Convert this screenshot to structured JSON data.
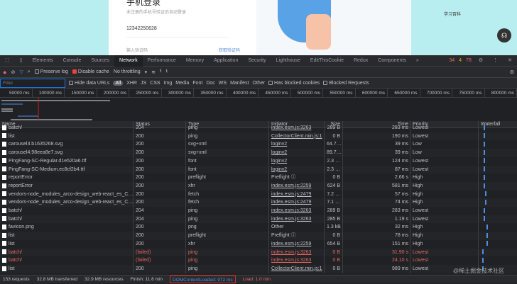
{
  "page": {
    "title": "手机登录",
    "subtitle": "未注册的手机号验证后自动登录",
    "phone": "12342250628",
    "code_placeholder": "输入验证码",
    "get_code": "获取验证码",
    "wiki": "学习百科"
  },
  "devtools": {
    "tabs": [
      "Elements",
      "Console",
      "Sources",
      "Network",
      "Performance",
      "Memory",
      "Application",
      "Security",
      "Lighthouse",
      "EditThisCookie",
      "Redux",
      "Components",
      "»"
    ],
    "active_tab": "Network",
    "badges": {
      "errors": "34",
      "warnings": "4",
      "issues": "78"
    },
    "toolbar": {
      "preserve_log": "Preserve log",
      "disable_cache": "Disable cache",
      "throttling": "No throttling"
    },
    "filter": {
      "placeholder": "Filter",
      "hide_data_urls": "Hide data URLs",
      "types": [
        "All",
        "XHR",
        "JS",
        "CSS",
        "Img",
        "Media",
        "Font",
        "Doc",
        "WS",
        "Manifest",
        "Other"
      ],
      "blocked_cookies": "Has blocked cookies",
      "blocked_requests": "Blocked Requests"
    },
    "timeline": [
      "50000 ms",
      "100000 ms",
      "150000 ms",
      "200000 ms",
      "250000 ms",
      "300000 ms",
      "350000 ms",
      "400000 ms",
      "450000 ms",
      "500000 ms",
      "550000 ms",
      "600000 ms",
      "650000 ms",
      "700000 ms",
      "750000 ms",
      "800000 ms"
    ],
    "columns": [
      "Name",
      "Status",
      "Type",
      "Initiator",
      "Size",
      "Time",
      "Priority",
      "Waterfall"
    ],
    "rows": [
      {
        "name": "batch/",
        "status": "204",
        "type": "ping",
        "initiator": "index.esm.js:3263",
        "size": "289 B",
        "time": "283 ms",
        "priority": "Lowest"
      },
      {
        "name": "list",
        "status": "200",
        "type": "ping",
        "initiator": "CollectorClient.min.js:1",
        "size": "0 B",
        "time": "190 ms",
        "priority": "Lowest"
      },
      {
        "name": "carousel3.b1635268.svg",
        "status": "200",
        "type": "svg+xml",
        "initiator": "loginv2",
        "size": "64.7…",
        "time": "39 ms",
        "priority": "Low"
      },
      {
        "name": "carousel4.98eea8e7.svg",
        "status": "200",
        "type": "svg+xml",
        "initiator": "loginv2",
        "size": "89.7…",
        "time": "39 ms",
        "priority": "Low"
      },
      {
        "name": "PingFang-SC-Regular.d1e520a6.ttf",
        "status": "200",
        "type": "font",
        "initiator": "loginv2",
        "size": "2.3 …",
        "time": "124 ms",
        "priority": "Lowest"
      },
      {
        "name": "PingFang-SC-Medium.ec8cf2b4.ttf",
        "status": "200",
        "type": "font",
        "initiator": "loginv2",
        "size": "2.3 …",
        "time": "87 ms",
        "priority": "Lowest"
      },
      {
        "name": "reportError",
        "status": "200",
        "type": "preflight",
        "initiator": "Preflight ⓘ",
        "size": "0 B",
        "time": "2.66 s",
        "priority": "High"
      },
      {
        "name": "reportError",
        "status": "200",
        "type": "xhr",
        "initiator": "index.esm.js:2259",
        "size": "624 B",
        "time": "581 ms",
        "priority": "High"
      },
      {
        "name": "vendors-node_modules_arco-design_web-react_es_C…",
        "status": "200",
        "type": "fetch",
        "initiator": "index.esm.js:2479",
        "size": "7.2 …",
        "time": "57 ms",
        "priority": "High"
      },
      {
        "name": "vendors-node_modules_arco-design_web-react_es_C…",
        "status": "200",
        "type": "fetch",
        "initiator": "index.esm.js:2479",
        "size": "7.1 …",
        "time": "74 ms",
        "priority": "High"
      },
      {
        "name": "batch/",
        "status": "204",
        "type": "ping",
        "initiator": "index.esm.js:3263",
        "size": "289 B",
        "time": "283 ms",
        "priority": "Lowest"
      },
      {
        "name": "batch/",
        "status": "204",
        "type": "ping",
        "initiator": "index.esm.js:3263",
        "size": "285 B",
        "time": "1.19 s",
        "priority": "Lowest"
      },
      {
        "name": "favicon.png",
        "status": "200",
        "type": "png",
        "initiator": "Other",
        "size": "1.3 kB",
        "time": "32 ms",
        "priority": "High"
      },
      {
        "name": "list",
        "status": "200",
        "type": "preflight",
        "initiator": "Preflight ⓘ",
        "size": "0 B",
        "time": "78 ms",
        "priority": "High"
      },
      {
        "name": "list",
        "status": "200",
        "type": "xhr",
        "initiator": "index.esm.js:2259",
        "size": "654 B",
        "time": "151 ms",
        "priority": "High"
      },
      {
        "name": "batch/",
        "status": "(failed)",
        "type": "ping",
        "initiator": "index.esm.js:3263",
        "size": "0 B",
        "time": "31.90 s",
        "priority": "Lowest",
        "failed": true
      },
      {
        "name": "batch/",
        "status": "(failed)",
        "type": "ping",
        "initiator": "index.esm.js:3263",
        "size": "0 B",
        "time": "24.10 s",
        "priority": "Lowest",
        "failed": true
      },
      {
        "name": "list",
        "status": "200",
        "type": "ping",
        "initiator": "CollectorClient.min.js:1",
        "size": "0 B",
        "time": "989 ms",
        "priority": "Lowest"
      }
    ],
    "statusbar": {
      "requests": "153 requests",
      "transferred": "32.8 MB transferred",
      "resources": "32.9 MB resources",
      "finish": "Finish: 11.6 min",
      "dcl": "DOMContentLoaded: 972 ms",
      "load": "Load: 1.0 min"
    },
    "watermark": "@稀土掘金技术社区"
  }
}
